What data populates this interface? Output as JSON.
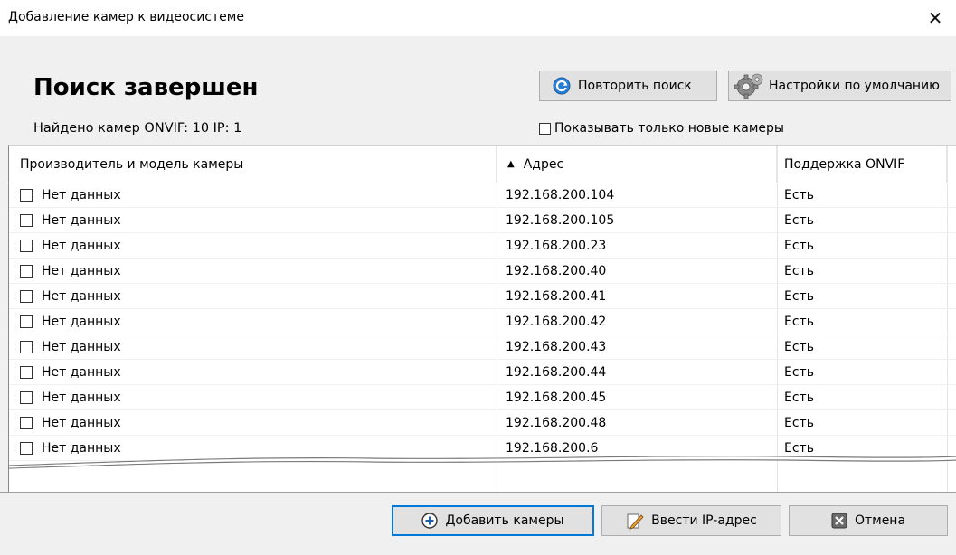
{
  "window": {
    "title": "Добавление камер к видеосистеме",
    "close_label": "✕"
  },
  "header": {
    "title": "Поиск завершен",
    "found_text": "Найдено камер ONVIF: 10 IP: 1",
    "repeat_search_label": "Повторить поиск",
    "default_settings_label": "Настройки по умолчанию",
    "show_only_new_label": "Показывать только новые камеры",
    "show_only_new_checked": false
  },
  "table": {
    "columns": {
      "model": "Производитель и модель камеры",
      "address": "Адрес",
      "onvif": "Поддержка ONVIF"
    },
    "sort_indicator": "▲",
    "rows": [
      {
        "model": "Нет данных",
        "address": "192.168.200.104",
        "onvif": "Есть"
      },
      {
        "model": "Нет данных",
        "address": "192.168.200.105",
        "onvif": "Есть"
      },
      {
        "model": "Нет данных",
        "address": "192.168.200.23",
        "onvif": "Есть"
      },
      {
        "model": "Нет данных",
        "address": "192.168.200.40",
        "onvif": "Есть"
      },
      {
        "model": "Нет данных",
        "address": "192.168.200.41",
        "onvif": "Есть"
      },
      {
        "model": "Нет данных",
        "address": "192.168.200.42",
        "onvif": "Есть"
      },
      {
        "model": "Нет данных",
        "address": "192.168.200.43",
        "onvif": "Есть"
      },
      {
        "model": "Нет данных",
        "address": "192.168.200.44",
        "onvif": "Есть"
      },
      {
        "model": "Нет данных",
        "address": "192.168.200.45",
        "onvif": "Есть"
      },
      {
        "model": "Нет данных",
        "address": "192.168.200.48",
        "onvif": "Есть"
      },
      {
        "model": "Нет данных",
        "address": "192.168.200.6",
        "onvif": "Есть"
      }
    ]
  },
  "footer": {
    "add_cameras_label": "Добавить камеры",
    "enter_ip_label": "Ввести IP-адрес",
    "cancel_label": "Отмена"
  },
  "icons": {
    "refresh": "refresh-icon",
    "settings": "gear-icon",
    "add": "plus-circle-icon",
    "edit": "pencil-icon",
    "cancel": "x-box-icon"
  },
  "colors": {
    "accent": "#0078d7",
    "window_bg": "#f0f0f0",
    "table_bg": "#ffffff"
  }
}
